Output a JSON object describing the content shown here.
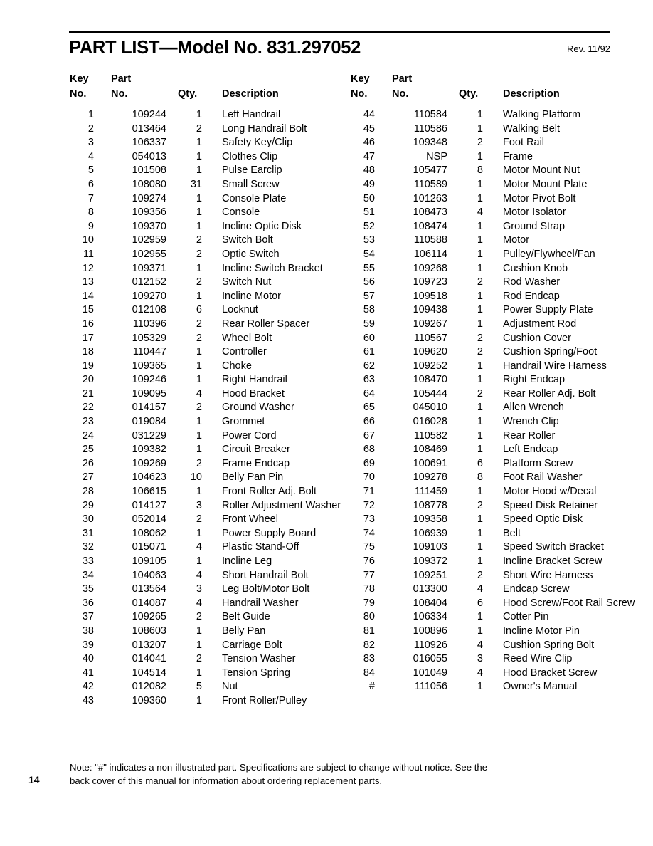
{
  "header": {
    "title": "PART LIST—Model No. 831.297052",
    "revision": "Rev. 11/92"
  },
  "columns": {
    "key_no_line1": "Key",
    "key_no_line2": "No.",
    "part_no_line1": "Part",
    "part_no_line2": "No.",
    "qty": "Qty.",
    "description": "Description"
  },
  "left_rows": [
    {
      "key": "1",
      "part": "109244",
      "qty": "1",
      "desc": "Left Handrail"
    },
    {
      "key": "2",
      "part": "013464",
      "qty": "2",
      "desc": "Long Handrail Bolt"
    },
    {
      "key": "3",
      "part": "106337",
      "qty": "1",
      "desc": "Safety Key/Clip"
    },
    {
      "key": "4",
      "part": "054013",
      "qty": "1",
      "desc": "Clothes Clip"
    },
    {
      "key": "5",
      "part": "101508",
      "qty": "1",
      "desc": "Pulse Earclip"
    },
    {
      "key": "6",
      "part": "108080",
      "qty": "31",
      "desc": "Small Screw"
    },
    {
      "key": "7",
      "part": "109274",
      "qty": "1",
      "desc": "Console Plate"
    },
    {
      "key": "8",
      "part": "109356",
      "qty": "1",
      "desc": "Console"
    },
    {
      "key": "9",
      "part": "109370",
      "qty": "1",
      "desc": "Incline Optic Disk"
    },
    {
      "key": "10",
      "part": "102959",
      "qty": "2",
      "desc": "Switch Bolt"
    },
    {
      "key": "11",
      "part": "102955",
      "qty": "2",
      "desc": "Optic Switch"
    },
    {
      "key": "12",
      "part": "109371",
      "qty": "1",
      "desc": "Incline Switch Bracket"
    },
    {
      "key": "13",
      "part": "012152",
      "qty": "2",
      "desc": "Switch Nut"
    },
    {
      "key": "14",
      "part": "109270",
      "qty": "1",
      "desc": "Incline Motor"
    },
    {
      "key": "15",
      "part": "012108",
      "qty": "6",
      "desc": "Locknut"
    },
    {
      "key": "16",
      "part": "110396",
      "qty": "2",
      "desc": "Rear Roller Spacer"
    },
    {
      "key": "17",
      "part": "105329",
      "qty": "2",
      "desc": "Wheel Bolt"
    },
    {
      "key": "18",
      "part": "110447",
      "qty": "1",
      "desc": "Controller"
    },
    {
      "key": "19",
      "part": "109365",
      "qty": "1",
      "desc": "Choke"
    },
    {
      "key": "20",
      "part": "109246",
      "qty": "1",
      "desc": "Right Handrail"
    },
    {
      "key": "21",
      "part": "109095",
      "qty": "4",
      "desc": "Hood Bracket"
    },
    {
      "key": "22",
      "part": "014157",
      "qty": "2",
      "desc": "Ground Washer"
    },
    {
      "key": "23",
      "part": "019084",
      "qty": "1",
      "desc": "Grommet"
    },
    {
      "key": "24",
      "part": "031229",
      "qty": "1",
      "desc": "Power Cord"
    },
    {
      "key": "25",
      "part": "109382",
      "qty": "1",
      "desc": "Circuit Breaker"
    },
    {
      "key": "26",
      "part": "109269",
      "qty": "2",
      "desc": "Frame Endcap"
    },
    {
      "key": "27",
      "part": "104623",
      "qty": "10",
      "desc": "Belly Pan Pin"
    },
    {
      "key": "28",
      "part": "106615",
      "qty": "1",
      "desc": "Front Roller Adj. Bolt"
    },
    {
      "key": "29",
      "part": "014127",
      "qty": "3",
      "desc": "Roller Adjustment Washer"
    },
    {
      "key": "30",
      "part": "052014",
      "qty": "2",
      "desc": "Front Wheel"
    },
    {
      "key": "31",
      "part": "108062",
      "qty": "1",
      "desc": "Power Supply Board"
    },
    {
      "key": "32",
      "part": "015071",
      "qty": "4",
      "desc": "Plastic Stand-Off"
    },
    {
      "key": "33",
      "part": "109105",
      "qty": "1",
      "desc": "Incline Leg"
    },
    {
      "key": "34",
      "part": "104063",
      "qty": "4",
      "desc": "Short Handrail Bolt"
    },
    {
      "key": "35",
      "part": "013564",
      "qty": "3",
      "desc": "Leg Bolt/Motor Bolt"
    },
    {
      "key": "36",
      "part": "014087",
      "qty": "4",
      "desc": "Handrail Washer"
    },
    {
      "key": "37",
      "part": "109265",
      "qty": "2",
      "desc": "Belt Guide"
    },
    {
      "key": "38",
      "part": "108603",
      "qty": "1",
      "desc": "Belly Pan"
    },
    {
      "key": "39",
      "part": "013207",
      "qty": "1",
      "desc": "Carriage Bolt"
    },
    {
      "key": "40",
      "part": "014041",
      "qty": "2",
      "desc": "Tension Washer"
    },
    {
      "key": "41",
      "part": "104514",
      "qty": "1",
      "desc": "Tension Spring"
    },
    {
      "key": "42",
      "part": "012082",
      "qty": "5",
      "desc": "Nut"
    },
    {
      "key": "43",
      "part": "109360",
      "qty": "1",
      "desc": "Front Roller/Pulley"
    }
  ],
  "right_rows": [
    {
      "key": "44",
      "part": "110584",
      "qty": "1",
      "desc": "Walking Platform"
    },
    {
      "key": "45",
      "part": "110586",
      "qty": "1",
      "desc": "Walking Belt"
    },
    {
      "key": "46",
      "part": "109348",
      "qty": "2",
      "desc": "Foot Rail"
    },
    {
      "key": "47",
      "part": "NSP",
      "qty": "1",
      "desc": "Frame"
    },
    {
      "key": "48",
      "part": "105477",
      "qty": "8",
      "desc": "Motor Mount Nut"
    },
    {
      "key": "49",
      "part": "110589",
      "qty": "1",
      "desc": "Motor Mount Plate"
    },
    {
      "key": "50",
      "part": "101263",
      "qty": "1",
      "desc": "Motor Pivot Bolt"
    },
    {
      "key": "51",
      "part": "108473",
      "qty": "4",
      "desc": "Motor Isolator"
    },
    {
      "key": "52",
      "part": "108474",
      "qty": "1",
      "desc": "Ground Strap"
    },
    {
      "key": "53",
      "part": "110588",
      "qty": "1",
      "desc": "Motor"
    },
    {
      "key": "54",
      "part": "106114",
      "qty": "1",
      "desc": "Pulley/Flywheel/Fan"
    },
    {
      "key": "55",
      "part": "109268",
      "qty": "1",
      "desc": "Cushion Knob"
    },
    {
      "key": "56",
      "part": "109723",
      "qty": "2",
      "desc": "Rod Washer"
    },
    {
      "key": "57",
      "part": "109518",
      "qty": "1",
      "desc": "Rod Endcap"
    },
    {
      "key": "58",
      "part": "109438",
      "qty": "1",
      "desc": "Power Supply Plate"
    },
    {
      "key": "59",
      "part": "109267",
      "qty": "1",
      "desc": "Adjustment Rod"
    },
    {
      "key": "60",
      "part": "110567",
      "qty": "2",
      "desc": "Cushion Cover"
    },
    {
      "key": "61",
      "part": "109620",
      "qty": "2",
      "desc": "Cushion Spring/Foot"
    },
    {
      "key": "62",
      "part": "109252",
      "qty": "1",
      "desc": "Handrail Wire Harness"
    },
    {
      "key": "63",
      "part": "108470",
      "qty": "1",
      "desc": "Right Endcap"
    },
    {
      "key": "64",
      "part": "105444",
      "qty": "2",
      "desc": "Rear Roller Adj. Bolt"
    },
    {
      "key": "65",
      "part": "045010",
      "qty": "1",
      "desc": "Allen Wrench"
    },
    {
      "key": "66",
      "part": "016028",
      "qty": "1",
      "desc": "Wrench Clip"
    },
    {
      "key": "67",
      "part": "110582",
      "qty": "1",
      "desc": "Rear Roller"
    },
    {
      "key": "68",
      "part": "108469",
      "qty": "1",
      "desc": "Left Endcap"
    },
    {
      "key": "69",
      "part": "100691",
      "qty": "6",
      "desc": "Platform Screw"
    },
    {
      "key": "70",
      "part": "109278",
      "qty": "8",
      "desc": "Foot Rail Washer"
    },
    {
      "key": "71",
      "part": "111459",
      "qty": "1",
      "desc": "Motor Hood w/Decal"
    },
    {
      "key": "72",
      "part": "108778",
      "qty": "2",
      "desc": "Speed Disk Retainer"
    },
    {
      "key": "73",
      "part": "109358",
      "qty": "1",
      "desc": "Speed Optic Disk"
    },
    {
      "key": "74",
      "part": "106939",
      "qty": "1",
      "desc": "Belt"
    },
    {
      "key": "75",
      "part": "109103",
      "qty": "1",
      "desc": "Speed Switch Bracket"
    },
    {
      "key": "76",
      "part": "109372",
      "qty": "1",
      "desc": "Incline Bracket Screw"
    },
    {
      "key": "77",
      "part": "109251",
      "qty": "2",
      "desc": "Short Wire Harness"
    },
    {
      "key": "78",
      "part": "013300",
      "qty": "4",
      "desc": "Endcap Screw"
    },
    {
      "key": "79",
      "part": "108404",
      "qty": "6",
      "desc": "Hood Screw/Foot Rail Screw"
    },
    {
      "key": "80",
      "part": "106334",
      "qty": "1",
      "desc": "Cotter Pin"
    },
    {
      "key": "81",
      "part": "100896",
      "qty": "1",
      "desc": "Incline Motor Pin"
    },
    {
      "key": "82",
      "part": "110926",
      "qty": "4",
      "desc": "Cushion Spring Bolt"
    },
    {
      "key": "83",
      "part": "016055",
      "qty": "3",
      "desc": "Reed Wire Clip"
    },
    {
      "key": "84",
      "part": "101049",
      "qty": "4",
      "desc": "Hood Bracket Screw"
    },
    {
      "key": "#",
      "part": "111056",
      "qty": "1",
      "desc": "Owner's Manual"
    }
  ],
  "footer": {
    "page_number": "14",
    "note_line1": "Note:  \"#\" indicates a non-illustrated part.  Specifications are subject to change without notice.  See the",
    "note_line2": "back cover of this manual for information about ordering replacement parts."
  }
}
